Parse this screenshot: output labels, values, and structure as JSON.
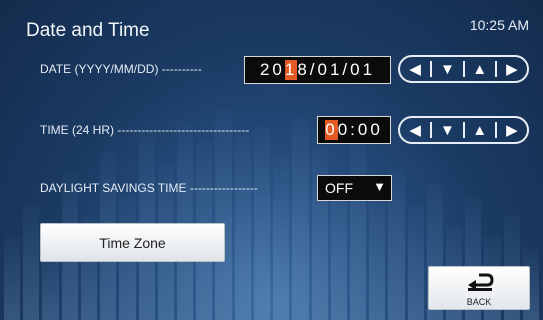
{
  "header": {
    "title": "Date and Time",
    "clock": "10:25 AM"
  },
  "date_row": {
    "label": "DATE (YYYY/MM/DD) ----------",
    "value_before_cursor": "20",
    "value_cursor": "1",
    "value_after_cursor": "8/01/01"
  },
  "time_row": {
    "label": "TIME (24 HR) ---------------------------------",
    "value_cursor": "0",
    "value_after_cursor": "0:00"
  },
  "dst_row": {
    "label": "DAYLIGHT SAVINGS TIME -----------------",
    "selected": "OFF"
  },
  "arrows": {
    "left": "◀",
    "down": "▼",
    "up": "▲",
    "right": "▶"
  },
  "dropdown_caret": "▼",
  "buttons": {
    "time_zone": "Time Zone",
    "back": "BACK"
  },
  "colors": {
    "cursor": "#e35a22",
    "value_box": "#0b0b0b"
  },
  "icons": [
    "left-arrow-icon",
    "down-arrow-icon",
    "up-arrow-icon",
    "right-arrow-icon",
    "back-return-icon"
  ]
}
